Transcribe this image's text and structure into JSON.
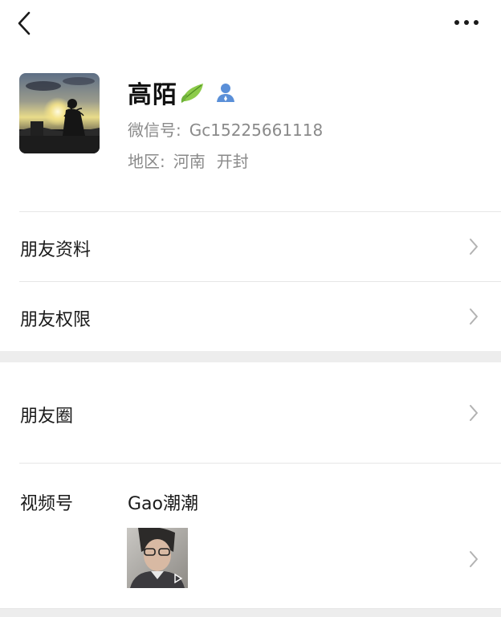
{
  "profile": {
    "name": "高陌",
    "wechat_id_label": "微信号:",
    "wechat_id": "Gc15225661118",
    "region_label": "地区:",
    "province": "河南",
    "city": "开封"
  },
  "rows": {
    "friend_info": "朋友资料",
    "friend_permissions": "朋友权限",
    "moments": "朋友圈",
    "channels": "视频号"
  },
  "channels": {
    "name": "Gao潮潮"
  },
  "icons": {
    "back": "chevron-left-icon",
    "more": "more-horizontal-icon",
    "leaf": "leaf-icon",
    "contact": "contact-person-icon",
    "arrow": "chevron-right-icon",
    "play": "play-icon"
  },
  "colors": {
    "background": "#ffffff",
    "section_gap": "#ededed",
    "secondary_text": "#8a8a8a",
    "chevron": "#b2b2b2",
    "contact_icon": "#5a8fd8",
    "leaf": "#7fc241"
  }
}
